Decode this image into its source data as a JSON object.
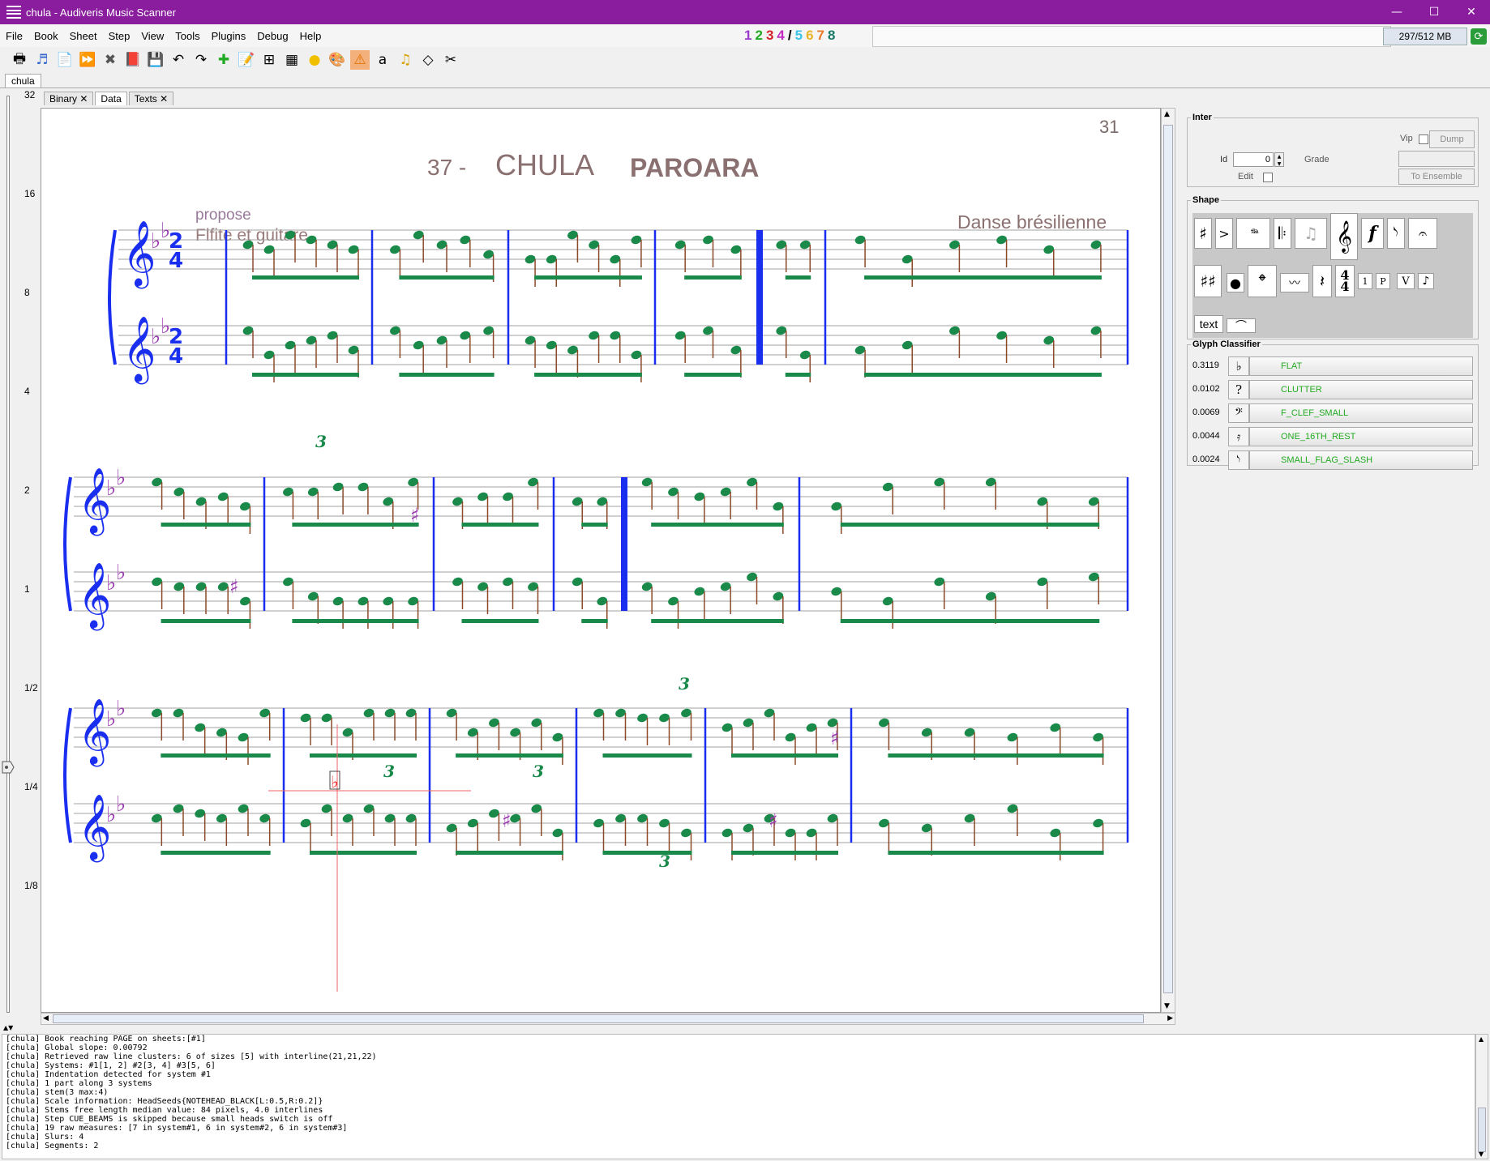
{
  "window": {
    "title": "chula - Audiveris Music Scanner",
    "controls": [
      "—",
      "☐",
      "✕"
    ]
  },
  "menu": [
    "File",
    "Book",
    "Sheet",
    "Step",
    "View",
    "Tools",
    "Plugins",
    "Debug",
    "Help"
  ],
  "steps": [
    {
      "label": "1",
      "color": "#9b3bd0"
    },
    {
      "label": "2",
      "color": "#22aa22"
    },
    {
      "label": "3",
      "color": "#d4222a"
    },
    {
      "label": "4",
      "color": "#c12bc1"
    },
    {
      "label": "/",
      "color": "#000000"
    },
    {
      "label": "5",
      "color": "#3cc4e8"
    },
    {
      "label": "6",
      "color": "#e8b52a"
    },
    {
      "label": "7",
      "color": "#e87a2a"
    },
    {
      "label": "8",
      "color": "#1a7a6a"
    }
  ],
  "memory": "297/512 MB",
  "toolbar_icons": [
    "print-icon",
    "export-music-icon",
    "load-sheet-icon",
    "fast-forward-icon",
    "close-icon",
    "pdf-icon",
    "save-icon",
    "undo-icon",
    "redo-icon",
    "add-icon",
    "transcribe-icon",
    "grid-icon",
    "grid-details-icon",
    "yellow-dot-icon",
    "palette-icon",
    "warning-icon",
    "text-icon",
    "music-note-icon",
    "eraser-icon",
    "scissors-icon"
  ],
  "book_tab": "chula",
  "sheet_tabs": [
    {
      "label": "Binary",
      "closable": true
    },
    {
      "label": "Data",
      "closable": false,
      "active": true
    },
    {
      "label": "Texts",
      "closable": true
    }
  ],
  "zoom_ticks": [
    "32",
    "16",
    "8",
    "4",
    "2",
    "1",
    "1/2",
    "1/4",
    "1/8"
  ],
  "score": {
    "page_number": "31",
    "title_number": "37 -",
    "title_main": "CHULA",
    "title_sub": "PAROARA",
    "instrumentation_line1": "propose",
    "instrumentation_line2": "Flfite  et  guitare",
    "style": "Danse  brésilienne",
    "time_signature_top": "2",
    "time_signature_bottom": "4",
    "triplet": "3"
  },
  "inter_panel": {
    "legend": "Inter",
    "vip_label": "Vip",
    "dump_label": "Dump",
    "id_label": "Id",
    "id_value": "0",
    "grade_label": "Grade",
    "edit_label": "Edit",
    "to_ensemble_label": "To Ensemble"
  },
  "shape_panel": {
    "legend": "Shape",
    "text_label": "text",
    "small_labels": [
      "1",
      "P",
      "V"
    ]
  },
  "classifier": {
    "legend": "Glyph Classifier",
    "results": [
      {
        "score": "0.3119",
        "name": "FLAT",
        "icon": "flat-icon",
        "glyph": "♭"
      },
      {
        "score": "0.0102",
        "name": "CLUTTER",
        "icon": "clutter-icon",
        "glyph": "?"
      },
      {
        "score": "0.0069",
        "name": "F_CLEF_SMALL",
        "icon": "f-clef-icon",
        "glyph": "𝄢"
      },
      {
        "score": "0.0044",
        "name": "ONE_16TH_REST",
        "icon": "sixteenth-rest-icon",
        "glyph": "𝄿"
      },
      {
        "score": "0.0024",
        "name": "SMALL_FLAG_SLASH",
        "icon": "flag-slash-icon",
        "glyph": "𝅮"
      }
    ]
  },
  "log": [
    "[chula] Book reaching PAGE on sheets:[#1]",
    "[chula] Global slope: 0.00792",
    "[chula] Retrieved raw line clusters: 6 of sizes [5] with interline(21,21,22)",
    "[chula] Systems: #1[1, 2] #2[3, 4] #3[5, 6]",
    "[chula] Indentation detected for system #1",
    "[chula] 1 part along 3 systems",
    "[chula] stem(3 max:4)",
    "[chula] Scale information: HeadSeeds{NOTEHEAD_BLACK[L:0.5,R:0.2]}",
    "[chula] Stems free length median value: 84 pixels, 4.0 interlines",
    "[chula] Step CUE_BEAMS is skipped because small heads switch is off",
    "[chula] 19 raw measures: [7 in system#1, 6 in system#2, 6 in system#3]",
    "[chula] Slurs: 4",
    "[chula] Segments: 2"
  ]
}
